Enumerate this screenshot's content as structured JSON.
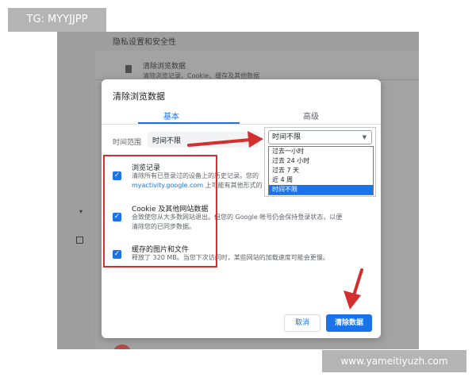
{
  "watermark_top": "TG: MYYJJPP",
  "watermark_bottom": "www.yameitiyuzh.com",
  "background": {
    "section_title": "隐私设置和安全性",
    "row_title": "清除浏览数据",
    "row_subtitle": "清除浏览记录、Cookie、缓存及其他数据"
  },
  "dialog": {
    "title": "清除浏览数据",
    "tabs": [
      {
        "label": "基本",
        "active": true
      },
      {
        "label": "高级",
        "active": false
      }
    ],
    "time_range": {
      "label": "时间范围",
      "value": "时间不限"
    },
    "items": [
      {
        "title": "浏览记录",
        "desc_line1": "清除所有已登录过的设备上的历史记录。您的",
        "desc_line2_link": "myactivity.google.com",
        "desc_line2_rest": " 上可能有其他形式的",
        "checked": true
      },
      {
        "title": "Cookie 及其他网站数据",
        "desc_line1": "会致使您从大多数网站退出。但您的 Google 帐号仍会保持登录状态，以便",
        "desc_line2": "清除您的已同步数据。",
        "checked": true
      },
      {
        "title": "缓存的图片和文件",
        "desc_line1": "释放了 320 MB。当您下次访问时，某些网站的加载速度可能会更慢。",
        "checked": true
      }
    ],
    "buttons": {
      "cancel": "取消",
      "clear": "清除数据"
    }
  },
  "dropdown": {
    "selected": "时间不限",
    "options": [
      "过去一小时",
      "过去 24 小时",
      "过去 7 天",
      "近 4 周",
      "时间不限"
    ],
    "highlighted": "时间不限"
  },
  "colors": {
    "accent": "#1a73e8",
    "annotation_red": "#d32f2f"
  }
}
